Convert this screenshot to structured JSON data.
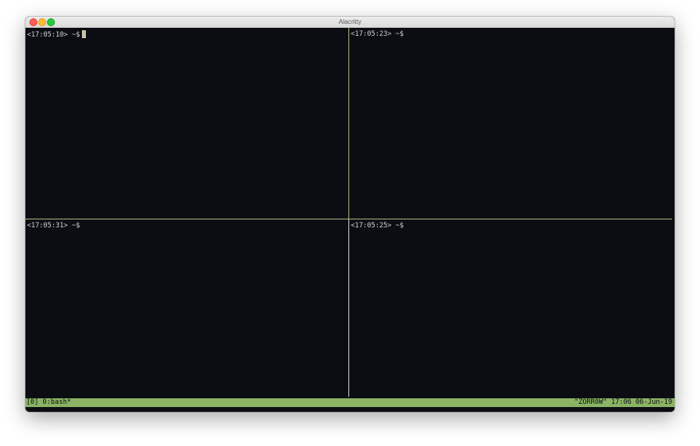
{
  "window": {
    "title": "Alacritty"
  },
  "panes": [
    {
      "prompt": "<17:05:10> ~$",
      "active": true
    },
    {
      "prompt": "<17:05:23> ~$",
      "active": false
    },
    {
      "prompt": "<17:05:31> ~$",
      "active": false
    },
    {
      "prompt": "<17:05:25> ~$",
      "active": false
    }
  ],
  "statusbar": {
    "left": "[0] 0:bash*",
    "right": "\"ZORR0W\" 17:06 06-Jun-19"
  },
  "colors": {
    "terminal_bg": "#0b0d13",
    "text": "#cfd2d6",
    "status_bg": "#8ab463",
    "active_border": "#a3b87a"
  }
}
